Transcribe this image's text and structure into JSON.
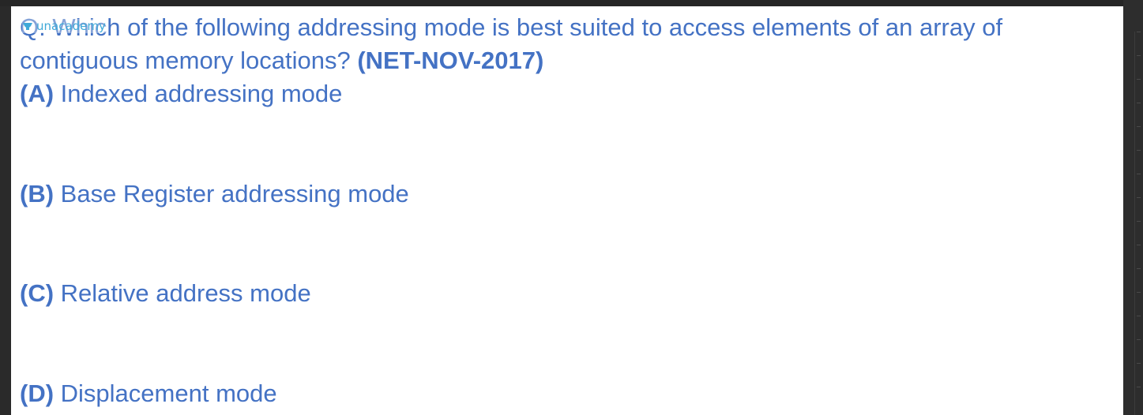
{
  "question": {
    "prefix": "Q. Which",
    "text": " of the following addressing mode is best suited to access elements of an array of contiguous memory locations? ",
    "reference": "(NET-NOV-2017)"
  },
  "watermark": {
    "brand": "unacademy",
    "icon": "unacademy-logo-icon"
  },
  "options": [
    {
      "letter": "(A)",
      "text": " Indexed addressing mode"
    },
    {
      "letter": "(B)",
      "text": " Base Register addressing mode"
    },
    {
      "letter": "(C)",
      "text": " Relative address mode"
    },
    {
      "letter": "(D)",
      "text": " Displacement mode"
    }
  ],
  "colors": {
    "text": "#4472c4",
    "slide_background": "#ffffff",
    "frame_background": "#2a2a2a",
    "logo": "#3fa9d8"
  }
}
